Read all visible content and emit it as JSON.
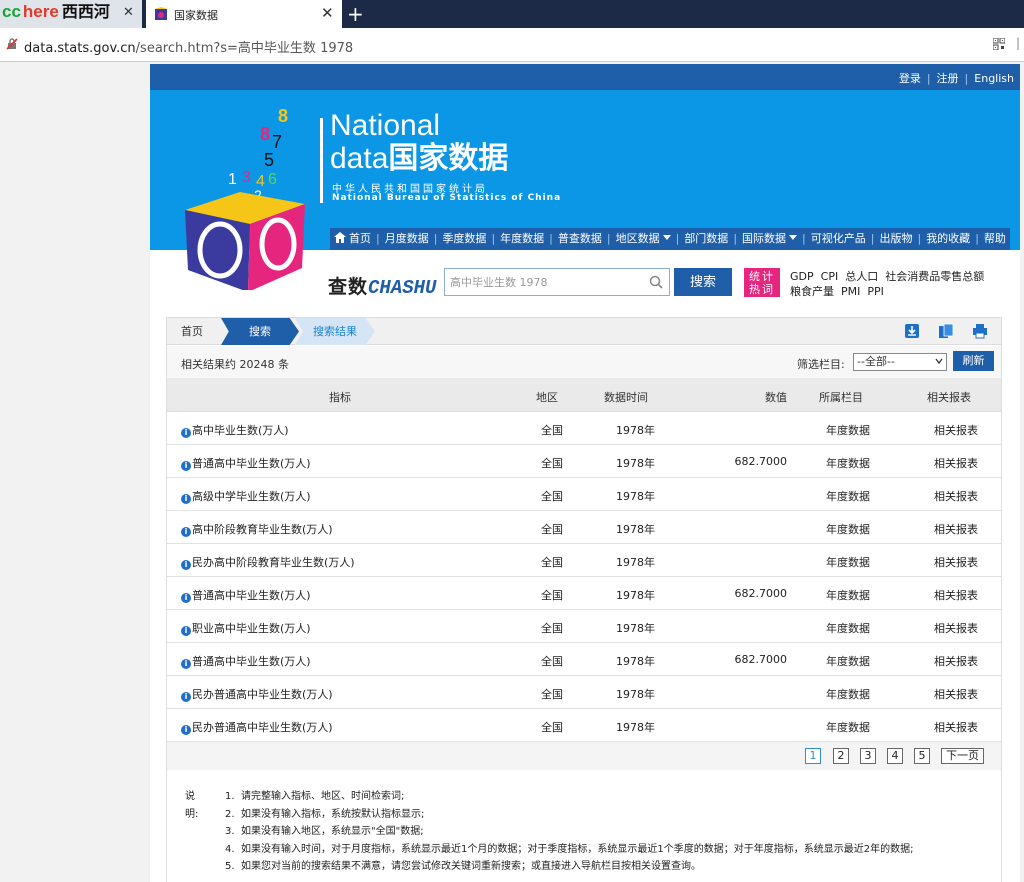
{
  "browser": {
    "bookmark": {
      "cc": "cc",
      "here": "here",
      "cn": "西西河"
    },
    "tab_title": "国家数据",
    "url_host": "data.stats.gov.cn",
    "url_path": "/search.htm?s=高中毕业生数 1978"
  },
  "topbar": {
    "login": "登录",
    "register": "注册",
    "english": "English"
  },
  "brand": {
    "en_line1": "National",
    "en_line2": "data",
    "cn_title": "国家数据",
    "cn_org": "中华人民共和国国家统计局",
    "en_org": "National Bureau of Statistics of China"
  },
  "nav": {
    "items": [
      "首页",
      "月度数据",
      "季度数据",
      "年度数据",
      "普查数据",
      "地区数据",
      "部门数据",
      "国际数据",
      "可视化产品",
      "出版物",
      "我的收藏",
      "帮助"
    ]
  },
  "search": {
    "logo_cn": "查数",
    "logo_en": "CHASHU",
    "value": "高中毕业生数 1978",
    "button": "搜索",
    "hot_badge_1": "统计",
    "hot_badge_2": "热词",
    "hot_words": [
      "GDP",
      "CPI",
      "总人口",
      "社会消费品零售总额",
      "粮食产量",
      "PMI",
      "PPI"
    ]
  },
  "breadcrumb": {
    "home": "首页",
    "search": "搜索",
    "result": "搜索结果"
  },
  "summary": {
    "count_text": "相关结果约 20248 条",
    "filter_label": "筛选栏目:",
    "filter_value": "--全部--",
    "refresh": "刷新"
  },
  "table": {
    "headers": {
      "name": "指标",
      "region": "地区",
      "time": "数据时间",
      "value": "数值",
      "column": "所属栏目",
      "report": "相关报表"
    },
    "rows": [
      {
        "name": "高中毕业生数(万人)",
        "region": "全国",
        "time": "1978年",
        "value": "",
        "column": "年度数据",
        "report": "相关报表"
      },
      {
        "name": "普通高中毕业生数(万人)",
        "region": "全国",
        "time": "1978年",
        "value": "682.7000",
        "column": "年度数据",
        "report": "相关报表"
      },
      {
        "name": "高级中学毕业生数(万人)",
        "region": "全国",
        "time": "1978年",
        "value": "",
        "column": "年度数据",
        "report": "相关报表"
      },
      {
        "name": "高中阶段教育毕业生数(万人)",
        "region": "全国",
        "time": "1978年",
        "value": "",
        "column": "年度数据",
        "report": "相关报表"
      },
      {
        "name": "民办高中阶段教育毕业生数(万人)",
        "region": "全国",
        "time": "1978年",
        "value": "",
        "column": "年度数据",
        "report": "相关报表"
      },
      {
        "name": "普通高中毕业生数(万人)",
        "region": "全国",
        "time": "1978年",
        "value": "682.7000",
        "column": "年度数据",
        "report": "相关报表"
      },
      {
        "name": "职业高中毕业生数(万人)",
        "region": "全国",
        "time": "1978年",
        "value": "",
        "column": "年度数据",
        "report": "相关报表"
      },
      {
        "name": "普通高中毕业生数(万人)",
        "region": "全国",
        "time": "1978年",
        "value": "682.7000",
        "column": "年度数据",
        "report": "相关报表"
      },
      {
        "name": "民办普通高中毕业生数(万人)",
        "region": "全国",
        "time": "1978年",
        "value": "",
        "column": "年度数据",
        "report": "相关报表"
      },
      {
        "name": "民办普通高中毕业生数(万人)",
        "region": "全国",
        "time": "1978年",
        "value": "",
        "column": "年度数据",
        "report": "相关报表"
      }
    ]
  },
  "pager": {
    "pages": [
      "1",
      "2",
      "3",
      "4",
      "5"
    ],
    "current": "1",
    "next": "下一页"
  },
  "notes": {
    "label": "说明:",
    "items": [
      "请完整输入指标、地区、时间检索词;",
      "如果没有输入指标，系统按默认指标显示;",
      "如果没有输入地区，系统显示\"全国\"数据;",
      "如果没有输入时间，对于月度指标，系统显示最近1个月的数据；对于季度指标，系统显示最近1个季度的数据；对于年度指标，系统显示最近2年的数据;",
      "如果您对当前的搜索结果不满意，请您尝试修改关键词重新搜索；或直接进入导航栏目按相关设置查询。"
    ]
  },
  "colors": {
    "brand_blue": "#1f5fa9",
    "banner_blue": "#0b96e6",
    "hot_pink": "#e6267e"
  }
}
